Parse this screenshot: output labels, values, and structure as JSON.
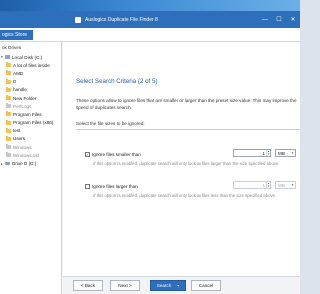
{
  "window": {
    "title": "Auslogics Duplicate File Finder 8",
    "minimize": "—",
    "maximize": "☐",
    "close": "✕"
  },
  "menu": {
    "store_tab": "ogics Store"
  },
  "sidebar": {
    "heading": "ok Drives",
    "items": [
      {
        "label": "Local Disk (C:)",
        "level": 0,
        "kind": "drive",
        "caret": "▾"
      },
      {
        "label": "A lot of files inside",
        "level": 1,
        "kind": "folder"
      },
      {
        "label": "AMD",
        "level": 1,
        "kind": "folder"
      },
      {
        "label": "D",
        "level": 1,
        "kind": "folder"
      },
      {
        "label": "handle",
        "level": 1,
        "kind": "folder"
      },
      {
        "label": "New Folder",
        "level": 1,
        "kind": "folder"
      },
      {
        "label": "PerfLogs",
        "level": 1,
        "kind": "folder-dim"
      },
      {
        "label": "Program Files",
        "level": 1,
        "kind": "folder"
      },
      {
        "label": "Program Files (x86)",
        "level": 1,
        "kind": "folder"
      },
      {
        "label": "test",
        "level": 1,
        "kind": "folder"
      },
      {
        "label": "Users",
        "level": 1,
        "kind": "folder"
      },
      {
        "label": "Windows",
        "level": 1,
        "kind": "folder-dim"
      },
      {
        "label": "Windows.old",
        "level": 1,
        "kind": "folder-dim"
      },
      {
        "label": "Drive D (D:)",
        "level": 0,
        "kind": "drive",
        "caret": "▸"
      }
    ]
  },
  "content": {
    "step_title": "Select Search Criteria (2 of 5)",
    "description": "These options allow to ignore files that are smaller or larger than the preset size value. This may improve the speed of duplicates search.",
    "select_label": "Select the file sizes to be ignored:",
    "option_smaller": {
      "label": "Ignore files smaller than",
      "checked": true,
      "check_glyph": "✓",
      "value": "1",
      "unit": "MB",
      "note": "If this option is enabled, duplicate search will only look at files larger than the size specified above."
    },
    "option_larger": {
      "label": "Ignore files larger than",
      "checked": false,
      "value": "1",
      "unit": "MB",
      "note": "If this option is enabled, duplicate search will only look at files less than the size specified above."
    }
  },
  "footer": {
    "back": "< Back",
    "next": "Next >",
    "search": "Search",
    "search_chevron": "▾",
    "cancel": "Cancel"
  },
  "colors": {
    "accent": "#2e6fbc",
    "title_blue": "#2a5ea7"
  }
}
